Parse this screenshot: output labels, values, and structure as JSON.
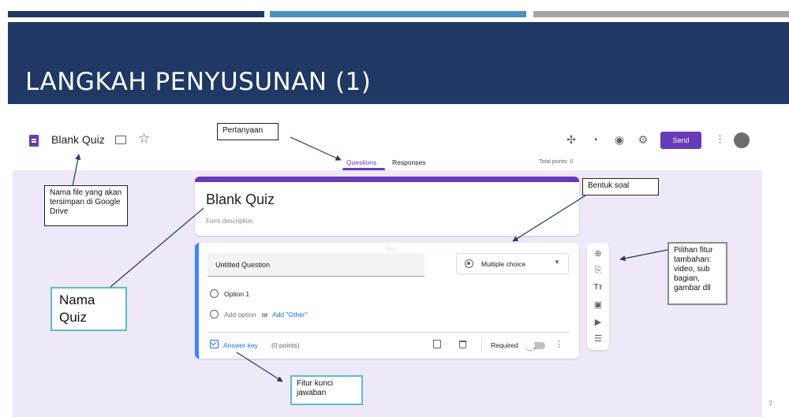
{
  "slide": {
    "title": "LANGKAH PENYUSUNAN (1)",
    "page_number": "7",
    "colors": {
      "banner": "#1f3864",
      "accent_blue": "#4a90c0",
      "accent_grey": "#a6a6a6"
    }
  },
  "app": {
    "doc_title": "Blank Quiz",
    "icons": [
      "forms-icon",
      "folder-icon",
      "star-icon",
      "puzzle-icon",
      "palette-icon",
      "eye-icon",
      "gear-icon",
      "more-vert-icon",
      "avatar"
    ],
    "send_label": "Send",
    "tabs": [
      {
        "label": "Questions",
        "active": true
      },
      {
        "label": "Responses",
        "active": false
      }
    ],
    "total_points": "Total points: 0",
    "colors": {
      "primary": "#673ab7",
      "link": "#1a73e8",
      "canvas": "#efe8f8"
    }
  },
  "form": {
    "title": "Blank Quiz",
    "description_placeholder": "Form description"
  },
  "question": {
    "title": "Untitled Question",
    "type": "Multiple choice",
    "options": [
      "Option 1"
    ],
    "add_option": "Add option",
    "or": "or",
    "add_other": "Add \"Other\"",
    "answer_key": "Answer key",
    "points": "(0 points)",
    "required_label": "Required",
    "required": false
  },
  "side_toolbar": [
    "add-question-icon",
    "import-questions-icon",
    "add-title-icon",
    "add-image-icon",
    "add-video-icon",
    "add-section-icon"
  ],
  "annotations": {
    "pertanyaan": "Pertanyaan",
    "nama_file": "Nama file yang akan tersimpan di Google Drive",
    "nama_quiz": "Nama Quiz",
    "bentuk_soal": "Bentuk soal",
    "pilihan_fitur": "Pilihan fitur tambahan: video, sub bagian, gambar dll",
    "fitur_kunci": "Fitur kunci jawaban"
  }
}
